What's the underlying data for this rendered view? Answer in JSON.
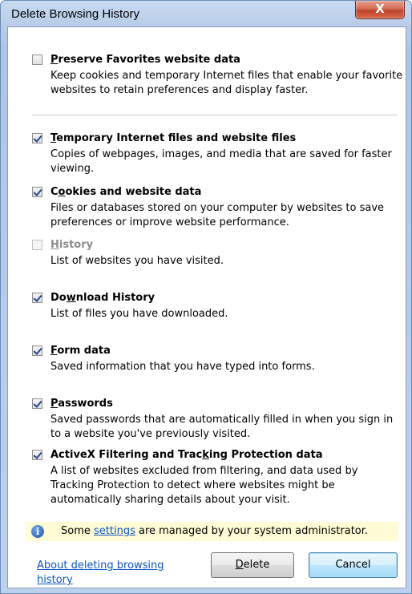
{
  "window": {
    "title": "Delete Browsing History",
    "close_label": "X"
  },
  "options": [
    {
      "id": "preserve-favorites",
      "label_before": "",
      "label_key": "P",
      "label_after": "reserve Favorites website data",
      "checked": false,
      "disabled": false,
      "description": "Keep cookies and temporary Internet files that enable your favorite websites to retain preferences and display faster."
    },
    {
      "id": "temporary-files",
      "label_before": "",
      "label_key": "T",
      "label_after": "emporary Internet files and website files",
      "checked": true,
      "disabled": false,
      "description": "Copies of webpages, images, and media that are saved for faster viewing."
    },
    {
      "id": "cookies",
      "label_before": "C",
      "label_key": "o",
      "label_after": "okies and website data",
      "checked": true,
      "disabled": false,
      "description": "Files or databases stored on your computer by websites to save preferences or improve website performance."
    },
    {
      "id": "history",
      "label_before": "",
      "label_key": "H",
      "label_after": "istory",
      "checked": false,
      "disabled": true,
      "description": "List of websites you have visited."
    },
    {
      "id": "download-history",
      "label_before": "Do",
      "label_key": "w",
      "label_after": "nload History",
      "checked": true,
      "disabled": false,
      "description": "List of files you have downloaded."
    },
    {
      "id": "form-data",
      "label_before": "",
      "label_key": "F",
      "label_after": "orm data",
      "checked": true,
      "disabled": false,
      "description": "Saved information that you have typed into forms."
    },
    {
      "id": "passwords",
      "label_before": "",
      "label_key": "P",
      "label_after": "asswords",
      "checked": true,
      "disabled": false,
      "description": "Saved passwords that are automatically filled in when you sign in to a website you've previously visited."
    },
    {
      "id": "activex",
      "label_before": "ActiveX Filtering and Trac",
      "label_key": "k",
      "label_after": "ing Protection data",
      "checked": true,
      "disabled": false,
      "description": "A list of websites excluded from filtering, and data used by Tracking Protection to detect where websites might be automatically sharing details about your visit."
    }
  ],
  "info": {
    "icon": "info-icon",
    "text_before": "Some ",
    "link": "settings",
    "text_after": " are managed by your system administrator."
  },
  "footer": {
    "about_link": "About deleting browsing history",
    "delete_before": "",
    "delete_key": "D",
    "delete_after": "elete",
    "cancel_label": "Cancel"
  },
  "colors": {
    "link": "#0d55c5",
    "info_bar": "#fffbd4",
    "close_button": "#c7452f",
    "check": "#22458f"
  }
}
